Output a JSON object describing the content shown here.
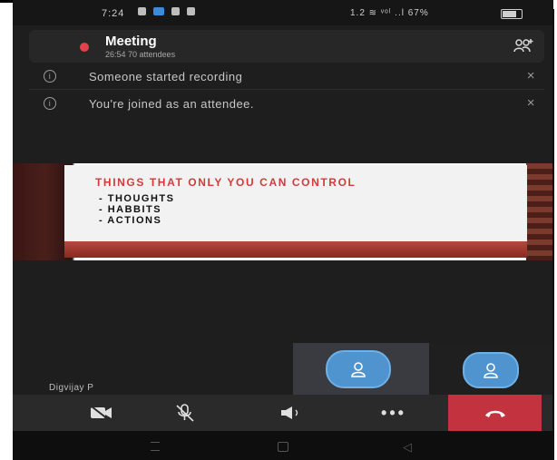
{
  "status_bar": {
    "time": "7:24",
    "right_text": "1.2 ≋ ᵛᵒˡ ..l 67%"
  },
  "meeting": {
    "title": "Meeting",
    "subtitle": "26:54  70 attendees",
    "participants_icon": "people-icon"
  },
  "notifications": [
    {
      "text": "Someone started recording",
      "icon": "info-icon",
      "close": "×"
    },
    {
      "text": "You're joined as an attendee.",
      "icon": "info-icon",
      "close": "×"
    }
  ],
  "slide": {
    "title": "THINGS  THAT ONLY YOU CAN CONTROL",
    "lines": [
      "- THOUGHTS",
      "- HABBITS",
      "- ACTIONS"
    ]
  },
  "presenter": {
    "name": "Digvijay P"
  },
  "controls": {
    "camera": "camera-off-icon",
    "mic": "mic-off-icon",
    "speaker": "speaker-icon",
    "more": "•••",
    "hangup": "hang-up-icon"
  },
  "colors": {
    "background": "#1e1e1e",
    "accent_blue": "#4f94cf",
    "hangup_red": "#c2323f",
    "recording_red": "#e0434b"
  }
}
